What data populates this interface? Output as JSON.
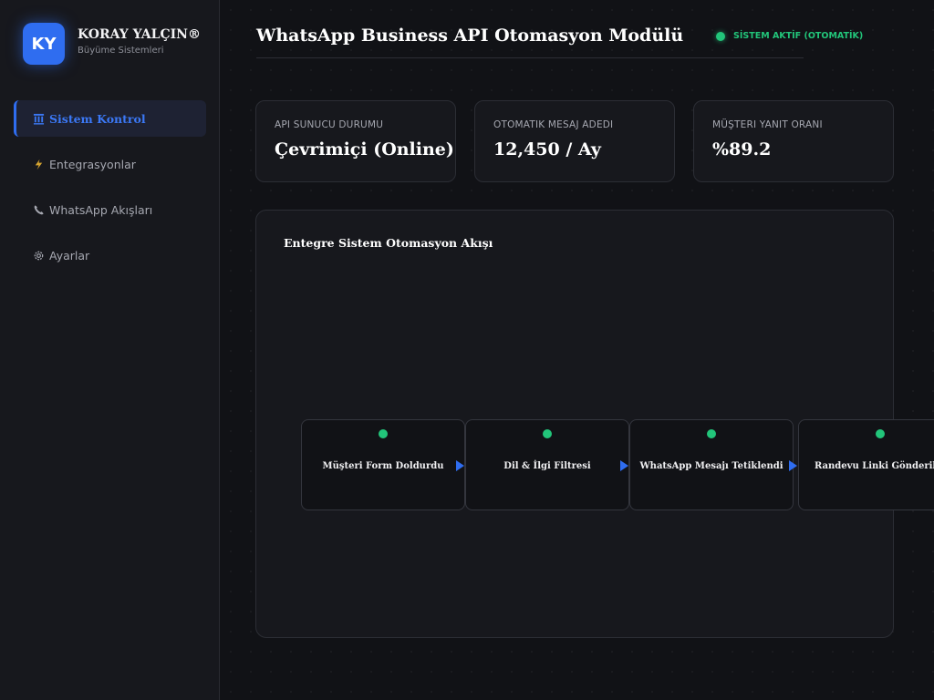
{
  "brand": {
    "initials": "KY",
    "name": "KORAY YALÇIN®",
    "subtitle": "Büyüme Sistemleri"
  },
  "sidebar": {
    "items": [
      {
        "label": "Sistem Kontrol",
        "icon": "building-columns-icon",
        "active": true
      },
      {
        "label": "Entegrasyonlar",
        "icon": "lightning-icon",
        "active": false
      },
      {
        "label": "WhatsApp Akışları",
        "icon": "phone-icon",
        "active": false
      },
      {
        "label": "Ayarlar",
        "icon": "gear-icon",
        "active": false
      }
    ]
  },
  "header": {
    "title": "WhatsApp Business API Otomasyon Modülü",
    "status": "SİSTEM AKTİF (OTOMATİK)"
  },
  "stats": [
    {
      "label": "API SUNUCU DURUMU",
      "value": "Çevrimiçi (Online)"
    },
    {
      "label": "OTOMATIK MESAJ ADEDI",
      "value": "12,450 / Ay"
    },
    {
      "label": "MÜŞTERI YANIT ORANI",
      "value": "%89.2"
    }
  ],
  "flow": {
    "title": "Entegre Sistem Otomasyon Akışı",
    "nodes": [
      {
        "label": "Müşteri Form Doldurdu"
      },
      {
        "label": "Dil & İlgi Filtresi"
      },
      {
        "label": "WhatsApp Mesajı Tetiklendi"
      },
      {
        "label": "Randevu Linki Gönderildi"
      }
    ]
  },
  "colors": {
    "accent": "#2f6df0",
    "success": "#22c57a",
    "background": "#111216",
    "panel": "#17181d"
  }
}
